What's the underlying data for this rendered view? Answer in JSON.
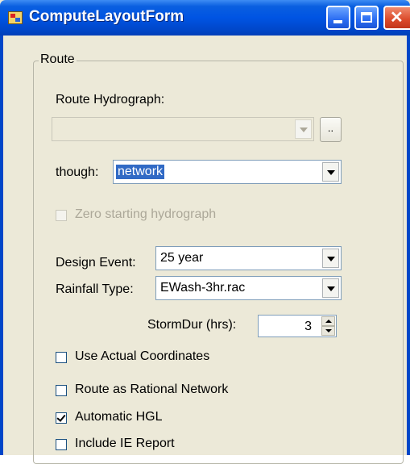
{
  "window": {
    "title": "ComputeLayoutForm",
    "icon": "app-form-icon",
    "controls": [
      "minimize-icon",
      "maximize-icon",
      "close-icon"
    ]
  },
  "route_group": {
    "legend": "Route",
    "route_hydrograph": {
      "label": "Route Hydrograph:",
      "value": "",
      "enabled": false,
      "browse_label": ".."
    },
    "though": {
      "label": "though:",
      "value": "network"
    },
    "zero_starting_hydrograph": {
      "label": "Zero starting hydrograph",
      "checked": false,
      "enabled": false
    },
    "design_event": {
      "label": "Design Event:",
      "value": "25 year"
    },
    "rainfall_type": {
      "label": "Rainfall Type:",
      "value": "EWash-3hr.rac"
    },
    "storm_duration": {
      "label": "StormDur (hrs):",
      "value": "3"
    },
    "options": [
      {
        "label": "Use Actual Coordinates",
        "checked": false
      },
      {
        "label": "Route as Rational Network",
        "checked": false
      },
      {
        "label": "Automatic HGL",
        "checked": true
      },
      {
        "label": "Include IE Report",
        "checked": false
      }
    ]
  }
}
